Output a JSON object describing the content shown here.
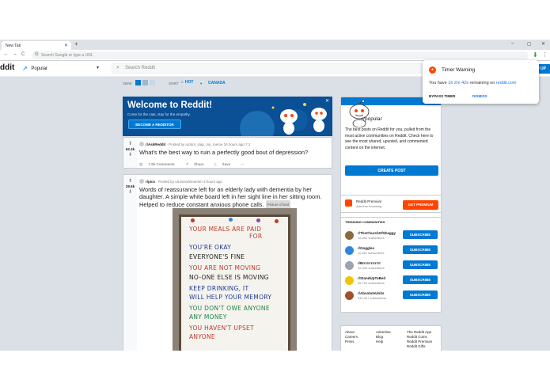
{
  "browser": {
    "tab_title": "New Tab",
    "tab_close": "✕",
    "new_tab": "+",
    "minimize": "–",
    "maximize": "▢",
    "close": "✕",
    "back": "←",
    "forward": "→",
    "reload": "C",
    "omnibox_placeholder": "Search Google or type a URL",
    "menu": "⋮"
  },
  "header": {
    "logo_text": "ddit",
    "feed_label": "Popular",
    "search_placeholder": "Search Reddit",
    "signup_label": "N UP"
  },
  "sortbar": {
    "view_label": "VIEW",
    "sort_label": "SORT",
    "sort_value": "HOT",
    "location_value": "CANADA"
  },
  "banner": {
    "title": "Welcome to Reddit!",
    "subtitle": "Come for the cats, stay for the empathy.",
    "button": "BECOME A REDDITOR"
  },
  "posts": [
    {
      "score": "62.4k",
      "subreddit": "r/AskReddit",
      "meta": "· Posted by u/dont_slap_my_meme 15 hours ago",
      "awards": "7  2",
      "title": "What's the best way to ruin a perfectly good bout of depression?",
      "comments": "7.5k Comments",
      "share": "Share",
      "save": "Save",
      "more": "···"
    },
    {
      "score": "28.6k",
      "subreddit": "r/pics",
      "meta": "· Posted by u/Lessonhnamen 3 hours ago",
      "title": "Words of reassurance left for an elderly lady with dementia by her daughter. A simple white board left in her sight line in her sitting room. Helped to reduce constant anxious phone calls.",
      "flair": "Picture of text",
      "board_lines": [
        {
          "text": "YOUR MEALS ARE PAID",
          "color": "#c0392b"
        },
        {
          "text": "FOR",
          "color": "#c0392b"
        },
        {
          "text": "YOU'RE OKAY",
          "color": "#1f3a93"
        },
        {
          "text": "EVERYONE'S FINE",
          "color": "#222222"
        },
        {
          "text": "YOU ARE NOT MOVING",
          "color": "#c0392b"
        },
        {
          "text": "NO-ONE ELSE IS MOVING",
          "color": "#222222"
        },
        {
          "text": "KEEP DRINKING, IT",
          "color": "#1f3a93"
        },
        {
          "text": "WILL HELP YOUR MEMORY",
          "color": "#1f3a93"
        },
        {
          "text": "YOU DON'T OWE ANYONE",
          "color": "#1e8449"
        },
        {
          "text": "ANY MONEY",
          "color": "#1e8449"
        },
        {
          "text": "YOU HAVEN'T UPSET",
          "color": "#c0392b"
        },
        {
          "text": "ANYONE",
          "color": "#c0392b"
        }
      ]
    }
  ],
  "sidebar": {
    "community_name": "r/popular",
    "community_desc": "The best posts on Reddit for you, pulled from the most active communities on Reddit. Check here to see the most shared, upvoted, and commented content on the internet.",
    "create_post": "CREATE POST",
    "premium_title": "Reddit Premium",
    "premium_sub": "Ads-free browsing",
    "get_premium": "GET PREMIUM",
    "trending_title": "TRENDING COMMUNITIES",
    "subscribe_label": "SUBSCRIBE",
    "communities": [
      {
        "name": "r/TheChurchOfShaggy",
        "subs": "16,892 subscribers",
        "color": "#8b6b3d"
      },
      {
        "name": "r/Goggles",
        "subs": "11,461 subscribers",
        "color": "#2e86de"
      },
      {
        "name": "r/Brrrrrrrrrrrrt",
        "subs": "12,340 subscribers",
        "color": "#9aa5b1"
      },
      {
        "name": "r/StandUpToBed",
        "subs": "26,703 subscribers",
        "color": "#f1c40f"
      },
      {
        "name": "r/AbsoluteUnits",
        "subs": "344,427 subscribers",
        "color": "#a0522d"
      }
    ],
    "footer": {
      "col1": [
        "About",
        "Careers",
        "Press"
      ],
      "col2": [
        "Advertise",
        "Blog",
        "Help"
      ],
      "col3": [
        "The Reddit App",
        "Reddit Coins",
        "Reddit Premium",
        "Reddit Gifts"
      ]
    }
  },
  "popup": {
    "title": "Timer Warning",
    "msg_prefix": "You have",
    "time_left": "1h 2m 42s",
    "msg_mid": "remaining on",
    "site": "reddit.com",
    "bypass": "BYPASS TIMER",
    "dismiss": "DISMISS"
  },
  "colors": {
    "reddit_blue": "#0079d3",
    "reddit_orange": "#ff4500",
    "page_bg": "#dae0e6"
  }
}
